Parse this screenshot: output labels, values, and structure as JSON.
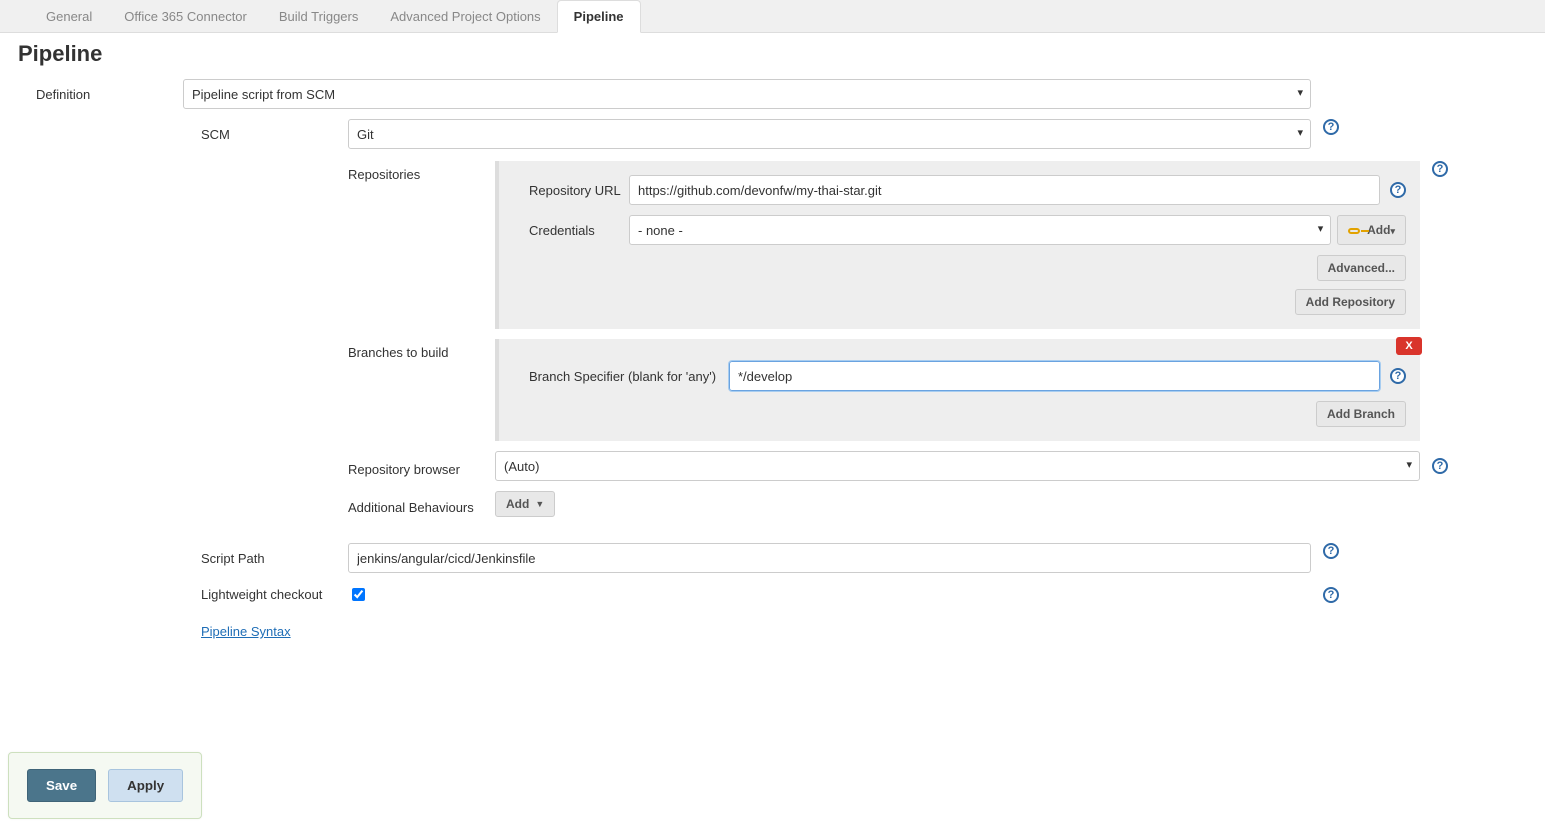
{
  "tabs": {
    "general": "General",
    "office365": "Office 365 Connector",
    "triggers": "Build Triggers",
    "advanced": "Advanced Project Options",
    "pipeline": "Pipeline"
  },
  "section": {
    "title": "Pipeline"
  },
  "definition": {
    "label": "Definition",
    "value": "Pipeline script from SCM"
  },
  "scm": {
    "label": "SCM",
    "value": "Git",
    "repositories": {
      "label": "Repositories",
      "url_label": "Repository URL",
      "url_value": "https://github.com/devonfw/my-thai-star.git",
      "cred_label": "Credentials",
      "cred_value": "- none -",
      "add_cred": "Add",
      "advanced_btn": "Advanced...",
      "add_repo_btn": "Add Repository"
    },
    "branches": {
      "label": "Branches to build",
      "spec_label": "Branch Specifier (blank for 'any')",
      "spec_value": "*/develop",
      "add_branch_btn": "Add Branch",
      "delete": "X"
    },
    "repo_browser": {
      "label": "Repository browser",
      "value": "(Auto)"
    },
    "additional": {
      "label": "Additional Behaviours",
      "add_btn": "Add"
    }
  },
  "script_path": {
    "label": "Script Path",
    "value": "jenkins/angular/cicd/Jenkinsfile"
  },
  "lightweight": {
    "label": "Lightweight checkout",
    "checked": true
  },
  "syntax_link": "Pipeline Syntax",
  "footer": {
    "save": "Save",
    "apply": "Apply"
  }
}
